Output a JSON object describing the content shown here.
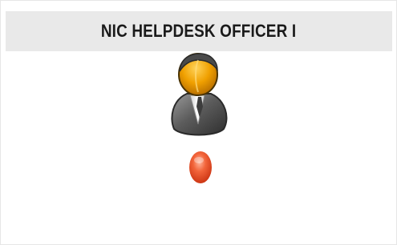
{
  "card": {
    "title": "NIC HELPDESK OFFICER I"
  },
  "avatar": {
    "icon": "user-avatar-icon",
    "colors": {
      "head": "#f0a000",
      "head_shade": "#c67a00",
      "body": "#6a6a6a",
      "body_dark": "#3a3a3a",
      "collar": "#ffffff"
    }
  },
  "status": {
    "icon": "status-dot-icon",
    "color": "#e8461f"
  },
  "colors": {
    "header_bg": "#e9e9e9",
    "title_text": "#1a1a1a",
    "page_bg": "#ffffff"
  }
}
